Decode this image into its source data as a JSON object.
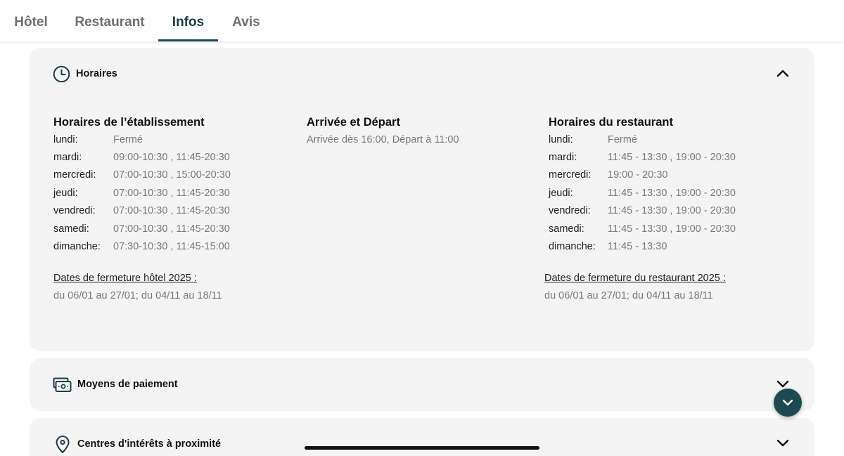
{
  "tabs": [
    {
      "label": "Hôtel"
    },
    {
      "label": "Restaurant"
    },
    {
      "label": "Infos"
    },
    {
      "label": "Avis"
    }
  ],
  "active_tab": "Infos",
  "accent_color": "#1d4a50",
  "horaires": {
    "title": "Horaires",
    "icon": "clock-icon",
    "establishment": {
      "title": "Horaires de l’établissement",
      "rows": [
        {
          "day": "lundi:",
          "hours": "Fermé"
        },
        {
          "day": "mardi:",
          "hours": "09:00-10:30 , 11:45-20:30"
        },
        {
          "day": "mercredi:",
          "hours": "07:00-10:30 , 15:00-20:30"
        },
        {
          "day": "jeudi:",
          "hours": "07:00-10:30 , 11:45-20:30"
        },
        {
          "day": "vendredi:",
          "hours": "07:00-10:30 , 11:45-20:30"
        },
        {
          "day": "samedi:",
          "hours": "07:00-10:30 , 11:45-20:30"
        },
        {
          "day": "dimanche:",
          "hours": "07:30-10:30 , 11:45-15:00"
        }
      ],
      "closing_label": "Dates de fermeture hôtel 2025 :",
      "closing_dates": "du 06/01 au 27/01; du 04/11 au 18/11"
    },
    "arrival": {
      "title": "Arrivée et Départ",
      "text": "Arrivée dès 16:00, Départ à 11:00"
    },
    "restaurant": {
      "title": "Horaires du restaurant",
      "rows": [
        {
          "day": "lundi:",
          "hours": "Fermé"
        },
        {
          "day": "mardi:",
          "hours": "11:45 - 13:30 , 19:00 - 20:30"
        },
        {
          "day": "mercredi:",
          "hours": "19:00 - 20:30"
        },
        {
          "day": "jeudi:",
          "hours": "11:45 - 13:30 , 19:00 - 20:30"
        },
        {
          "day": "vendredi:",
          "hours": "11:45 - 13:30 , 19:00 - 20:30"
        },
        {
          "day": "samedi:",
          "hours": "11:45 - 13:30 , 19:00 - 20:30"
        },
        {
          "day": "dimanche:",
          "hours": "11:45 - 13:30"
        }
      ],
      "closing_label": "Dates de fermeture du restaurant 2025 :",
      "closing_dates": "du 06/01 au 27/01; du 04/11 au 18/11"
    }
  },
  "paiement": {
    "title": "Moyens de paiement",
    "icon": "cash-icon"
  },
  "centres": {
    "title": "Centres d'intérêts à proximité",
    "icon": "location-pin-icon"
  }
}
